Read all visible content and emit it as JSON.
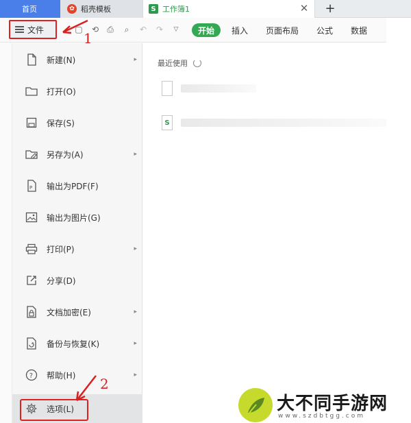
{
  "tabs": {
    "home": "首页",
    "template": "稻壳模板",
    "workbook": "工作簿1",
    "workbook_icon": "S"
  },
  "toolbar": {
    "file_label": "文件",
    "ribbon": [
      "开始",
      "插入",
      "页面布局",
      "公式",
      "数据"
    ]
  },
  "menu": {
    "items": [
      {
        "label": "新建(N)",
        "icon": "new-doc-icon",
        "submenu": true
      },
      {
        "label": "打开(O)",
        "icon": "folder-icon",
        "submenu": false
      },
      {
        "label": "保存(S)",
        "icon": "save-icon",
        "submenu": false
      },
      {
        "label": "另存为(A)",
        "icon": "save-as-icon",
        "submenu": true
      },
      {
        "label": "输出为PDF(F)",
        "icon": "pdf-icon",
        "submenu": false
      },
      {
        "label": "输出为图片(G)",
        "icon": "image-icon",
        "submenu": false
      },
      {
        "label": "打印(P)",
        "icon": "printer-icon",
        "submenu": true
      },
      {
        "label": "分享(D)",
        "icon": "share-icon",
        "submenu": false
      },
      {
        "label": "文档加密(E)",
        "icon": "lock-doc-icon",
        "submenu": true
      },
      {
        "label": "备份与恢复(K)",
        "icon": "backup-icon",
        "submenu": true
      },
      {
        "label": "帮助(H)",
        "icon": "help-icon",
        "submenu": true
      },
      {
        "label": "选项(L)",
        "icon": "gear-icon",
        "submenu": false
      }
    ]
  },
  "recent": {
    "title": "最近使用",
    "file_icon": "S"
  },
  "annotations": {
    "step1": "1",
    "step2": "2"
  },
  "watermark": {
    "text": "大不同手游网",
    "url": "www.szdbtgg.com"
  },
  "colors": {
    "accent_green": "#35a853",
    "highlight_red": "#e02020",
    "home_tab_blue": "#4a7ee8"
  }
}
